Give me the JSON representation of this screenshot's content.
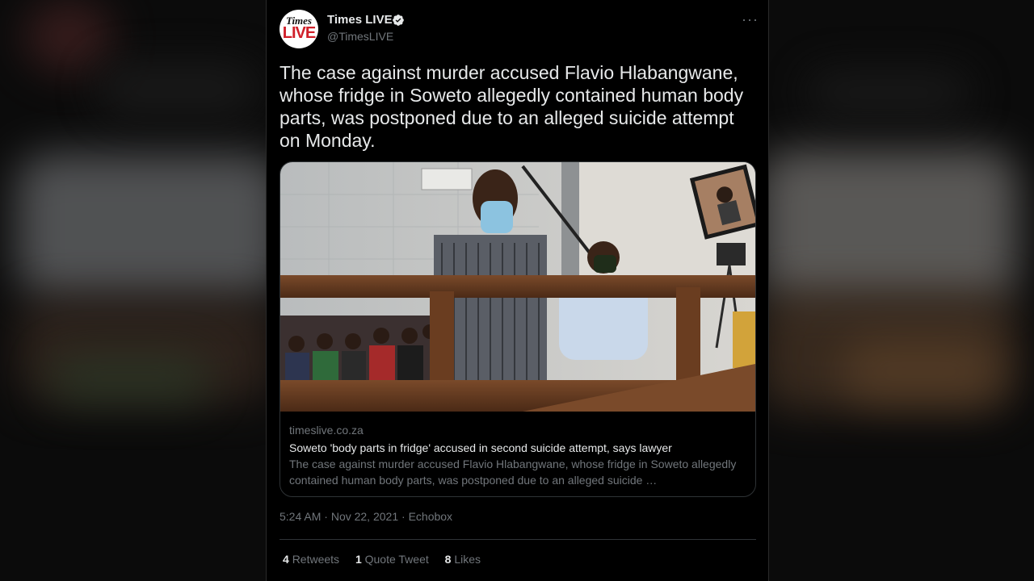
{
  "account": {
    "display_name": "Times LIVE",
    "handle": "@TimesLIVE",
    "avatar_text_top": "Times",
    "avatar_text_bottom": "LIVE",
    "verified_icon": "verified-badge-icon",
    "more_icon": "more-icon"
  },
  "tweet": {
    "text": "The case against murder accused Flavio Hlabangwane, whose fridge in Soweto allegedly contained human body parts, was postponed due to an alleged suicide attempt on Monday."
  },
  "link_card": {
    "domain": "timeslive.co.za",
    "headline": "Soweto 'body parts in fridge' accused in second suicide attempt, says lawyer",
    "description": "The case against murder accused Flavio Hlabangwane, whose fridge in Soweto allegedly contained human body parts, was postponed due to an alleged suicide …",
    "photo_icon": "courtroom-photo"
  },
  "meta": {
    "time": "5:24 AM",
    "date": "Nov 22, 2021",
    "source": "Echobox",
    "separator": "·"
  },
  "stats": {
    "retweets_count": "4",
    "retweets_label": "Retweets",
    "quotes_count": "1",
    "quotes_label": "Quote Tweet",
    "likes_count": "8",
    "likes_label": "Likes"
  },
  "colors": {
    "background": "#000000",
    "text_primary": "#e7e9ea",
    "text_secondary": "#71767b",
    "border": "#2f3336",
    "verified": "#e7e9ea"
  }
}
